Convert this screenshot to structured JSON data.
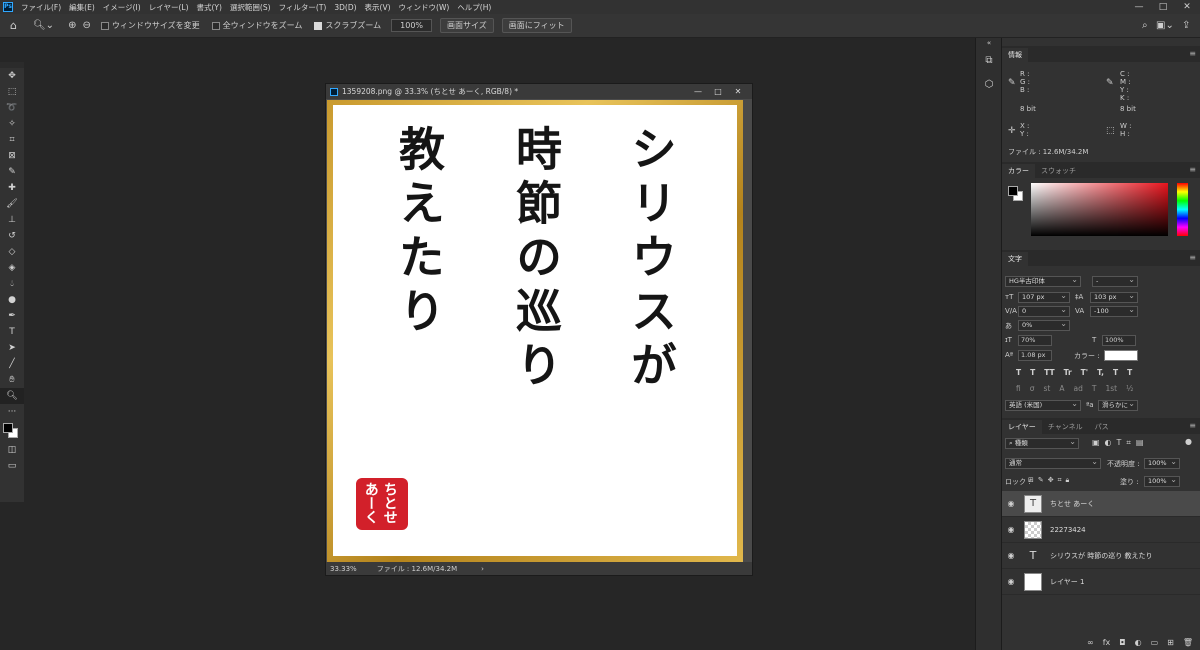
{
  "menu": {
    "logo": "Ps",
    "items": [
      "ファイル(F)",
      "編集(E)",
      "イメージ(I)",
      "レイヤー(L)",
      "書式(Y)",
      "選択範囲(S)",
      "フィルター(T)",
      "3D(D)",
      "表示(V)",
      "ウィンドウ(W)",
      "ヘルプ(H)"
    ],
    "window_controls": [
      "—",
      "□",
      "✕"
    ]
  },
  "options": {
    "home_icon": "home-icon",
    "resize_windows_label": "ウィンドウサイズを変更",
    "zoom_all_label": "全ウィンドウをズーム",
    "scrubby_zoom_label": "スクラブズーム",
    "scrubby_zoom_checked": true,
    "zoom_value": "100%",
    "fit_screen_label": "画面サイズ",
    "fill_screen_label": "画面にフィット"
  },
  "document": {
    "title": "1359208.png @ 33.3% (ちとせ あーく, RGB/8) *",
    "zoom": "33.33%",
    "file_info": "ファイル : 12.6M/34.2M",
    "columns": [
      "シリウスが",
      "時節の巡り",
      "教えたり"
    ],
    "seal_lines": [
      "ちとせ",
      "あーく"
    ],
    "seal_color": "#d2202a",
    "frame_color": "#c99a2e"
  },
  "panels": {
    "info": {
      "tab": "情報",
      "rgb_labels": [
        "R :",
        "G :",
        "B :"
      ],
      "cmyk_labels": [
        "C :",
        "M :",
        "Y :",
        "K :"
      ],
      "bit_left": "8 bit",
      "bit_right": "8 bit",
      "xy_labels": [
        "X :",
        "Y :"
      ],
      "wh_labels": [
        "W :",
        "H :"
      ],
      "file": "ファイル : 12.6M/34.2M"
    },
    "color": {
      "tabs": [
        "カラー",
        "スウォッチ"
      ]
    },
    "character": {
      "tab": "文字",
      "font": "HG半古印体",
      "style": "-",
      "size": "107 px",
      "leading": "103 px",
      "kerning": "0",
      "tracking": "-100",
      "tsume": "0%",
      "vscale": "70%",
      "hscale": "100%",
      "baseline": "1.08 px",
      "color_label": "カラー :",
      "language": "英語 (米国)",
      "antialias": "滑らかに",
      "format_buttons": [
        "T",
        "T",
        "TT",
        "Tr",
        "T'",
        "T,",
        "T",
        "T"
      ],
      "opentype_buttons": [
        "fi",
        "σ",
        "st",
        "A",
        "ad",
        "T",
        "1st",
        "½"
      ]
    },
    "layers": {
      "tabs": [
        "レイヤー",
        "チャンネル",
        "パス"
      ],
      "filter": "種類",
      "blend": "通常",
      "opacity_label": "不透明度 :",
      "opacity": "100%",
      "lock_label": "ロック :",
      "fill_label": "塗り :",
      "fill": "100%",
      "items": [
        {
          "name": "ちとせ あーく",
          "type": "text",
          "selected": true
        },
        {
          "name": "22273424",
          "type": "image",
          "selected": false
        },
        {
          "name": "シリウスが 時節の巡り 教えたり",
          "type": "text",
          "selected": false
        },
        {
          "name": "レイヤー 1",
          "type": "fill",
          "selected": false
        }
      ],
      "footer_icons": [
        "∞",
        "fx",
        "◘",
        "◐",
        "▭",
        "⊞",
        "🗑"
      ]
    }
  }
}
